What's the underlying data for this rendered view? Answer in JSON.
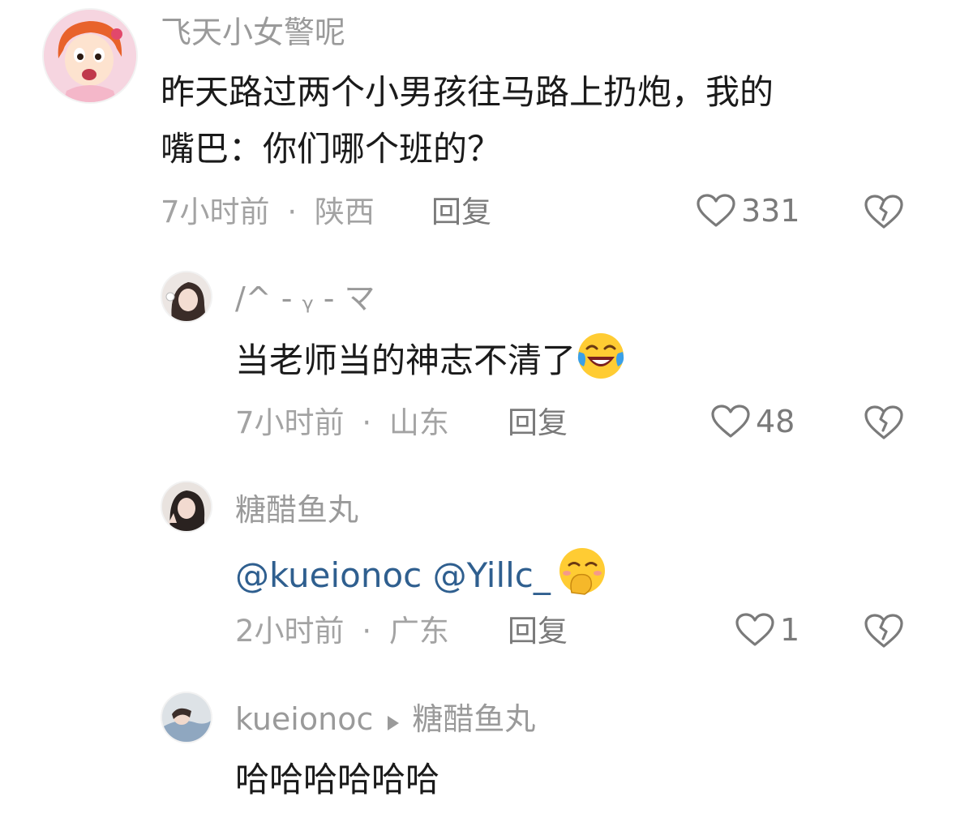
{
  "comments": [
    {
      "username": "飞天小女警呢",
      "content_line1": "昨天路过两个小男孩往马路上扔炮，我的",
      "content_line2": "嘴巴：你们哪个班的？",
      "time": "7小时前",
      "location": "陕西",
      "reply_label": "回复",
      "likes": "331"
    },
    {
      "username": "/^ - ᵧ - マ",
      "content": "当老师当的神志不清了",
      "emoji": "laughing-crying-emoji",
      "time": "7小时前",
      "location": "山东",
      "reply_label": "回复",
      "likes": "48"
    },
    {
      "username": "糖醋鱼丸",
      "mention1": "@kueionoc",
      "mention2": "@Yillc_",
      "emoji": "hand-over-mouth-emoji",
      "time": "2小时前",
      "location": "广东",
      "reply_label": "回复",
      "likes": "1"
    },
    {
      "username": "kueionoc",
      "reply_to": "糖醋鱼丸",
      "content": "哈哈哈哈哈哈"
    }
  ],
  "meta_separator": "·",
  "colors": {
    "username": "#9a9a9a",
    "text": "#1a1a1a",
    "meta": "#a3a3a3",
    "mention": "#2f5f8f",
    "icon": "#7a7a7a"
  }
}
